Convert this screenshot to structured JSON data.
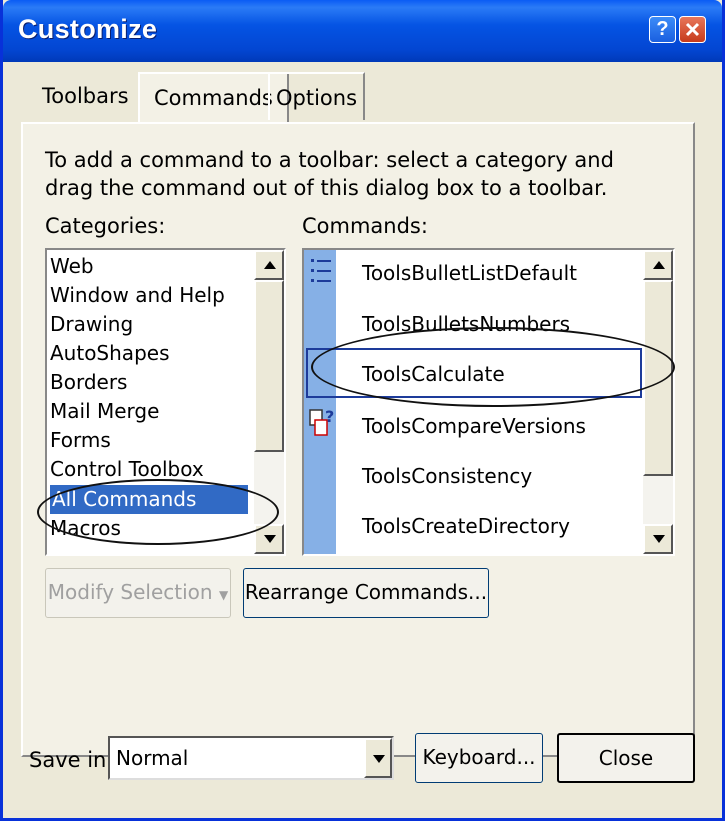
{
  "window": {
    "title": "Customize"
  },
  "titlebar_buttons": {
    "help": "?",
    "close_icon": "close-icon"
  },
  "tabs": [
    {
      "label": "Toolbars",
      "active": false
    },
    {
      "label": "Commands",
      "active": true
    },
    {
      "label": "Options",
      "active": false
    }
  ],
  "instructions": "To add a command to a toolbar: select a category and drag the command out of this dialog box to a toolbar.",
  "categories": {
    "label": "Categories:",
    "items": [
      "Web",
      "Window and Help",
      "Drawing",
      "AutoShapes",
      "Borders",
      "Mail Merge",
      "Forms",
      "Control Toolbox",
      "All Commands",
      "Macros"
    ],
    "selected": "All Commands"
  },
  "commands": {
    "label": "Commands:",
    "items": [
      {
        "label": "ToolsBulletListDefault",
        "icon": "bullet-list-icon"
      },
      {
        "label": "ToolsBulletsNumbers",
        "icon": ""
      },
      {
        "label": "ToolsCalculate",
        "icon": ""
      },
      {
        "label": "ToolsCompareVersions",
        "icon": "compare-versions-icon"
      },
      {
        "label": "ToolsConsistency",
        "icon": ""
      },
      {
        "label": "ToolsCreateDirectory",
        "icon": ""
      }
    ],
    "selected": "ToolsCalculate"
  },
  "buttons": {
    "modify_selection": "Modify Selection",
    "rearrange": "Rearrange Commands...",
    "keyboard": "Keyboard...",
    "close": "Close"
  },
  "save_in": {
    "label": "Save in:",
    "value": "Normal"
  },
  "colors": {
    "titlebar": "#0554e4",
    "selection": "#316ac5",
    "dialog_bg": "#ece9d8",
    "icon_strip": "#86b0e6"
  }
}
